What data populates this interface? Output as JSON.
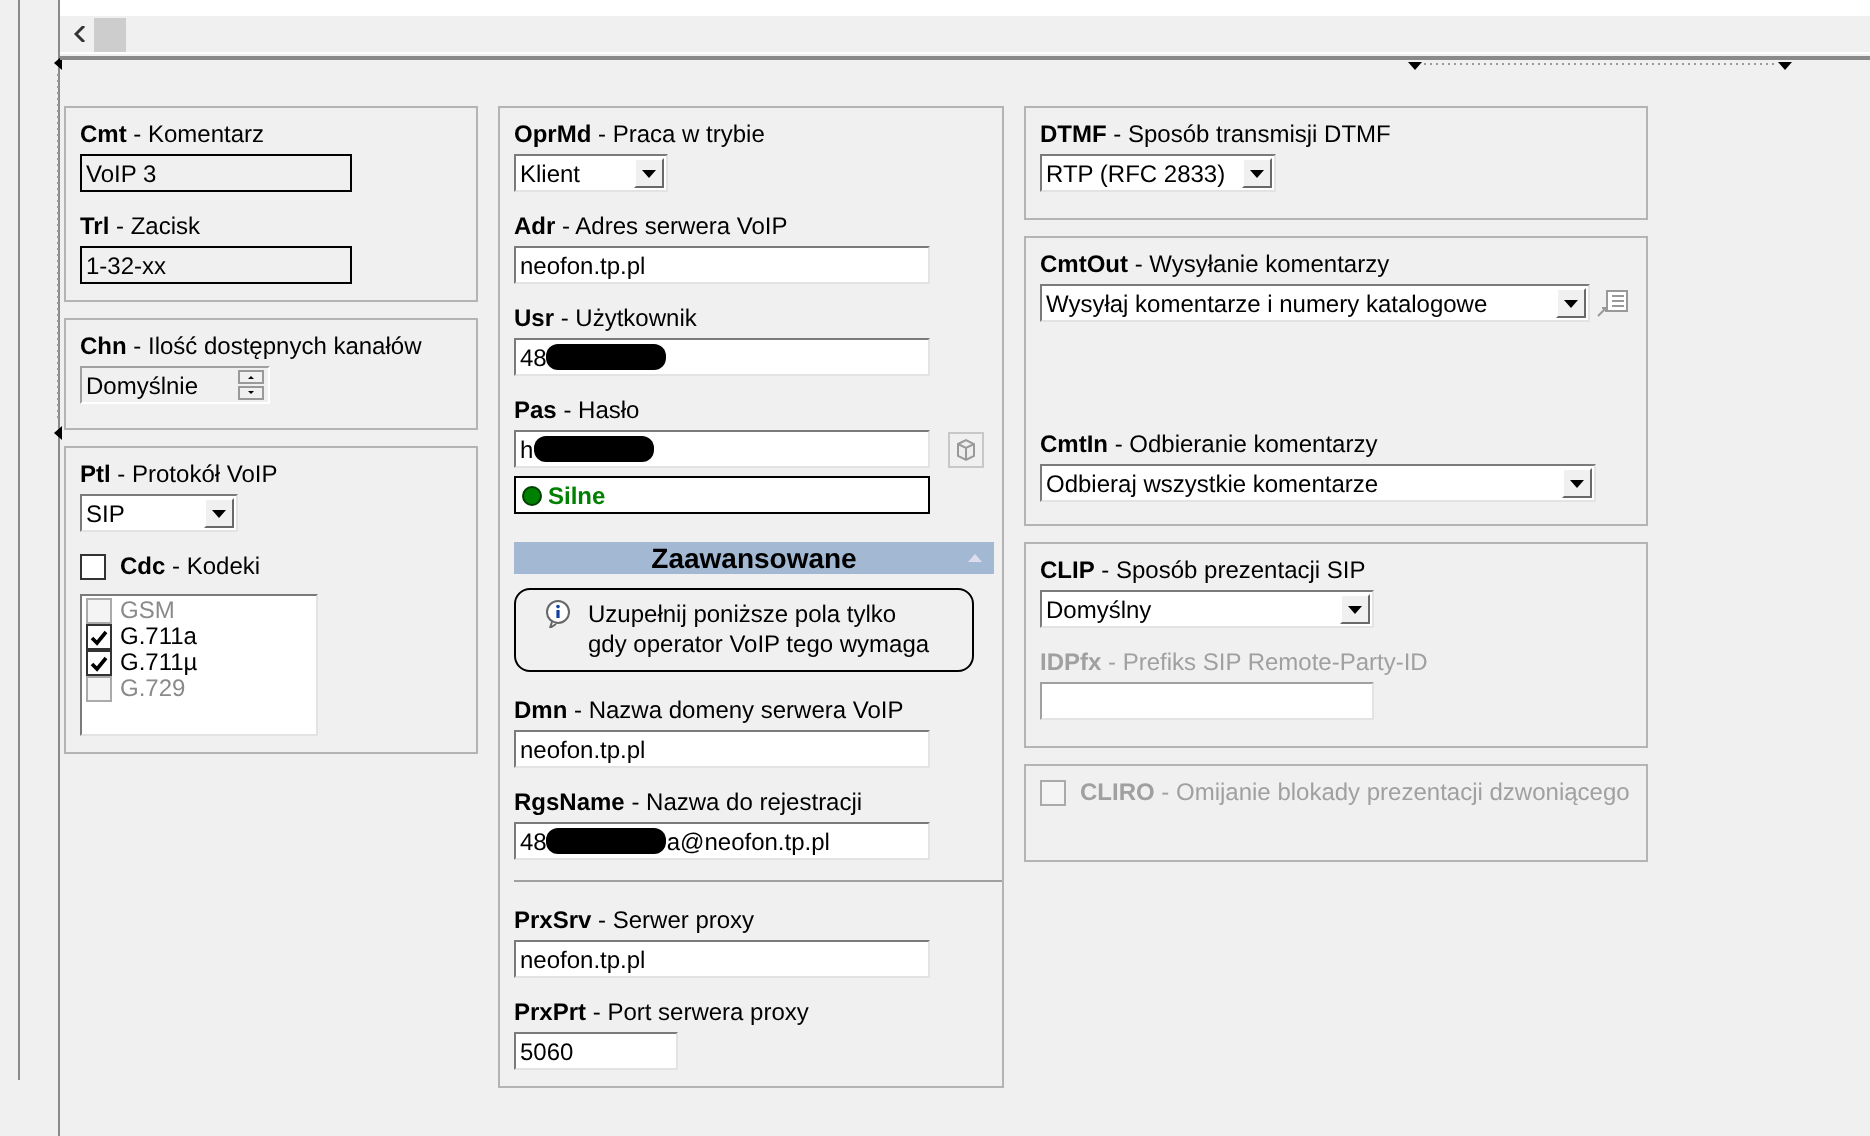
{
  "columns": [
    {
      "panels": [
        {
          "fields": [
            {
              "kind": "text",
              "label": "**Cmt** - Komentarz",
              "value": "VoIP 3",
              "readonly": true
            },
            {
              "kind": "text",
              "label": "**Trl** - Zacisk",
              "value": "1-32-xx",
              "readonly": true
            }
          ]
        },
        {
          "fields": [
            {
              "kind": "spin",
              "label": "**Chn** - Ilość dostępnych kanałów",
              "value": "Domyślnie"
            }
          ]
        },
        {
          "fields": [
            {
              "kind": "select",
              "label": "**Ptl** - Protokół VoIP",
              "value": "SIP"
            },
            {
              "kind": "checkbox",
              "label": "**Cdc** -  Kodeki",
              "checked": false,
              "disabled": false
            },
            {
              "kind": "checklist",
              "items": [
                {
                  "label": "GSM",
                  "checked": false,
                  "disabled": true
                },
                {
                  "label": "G.711a",
                  "checked": true,
                  "disabled": false
                },
                {
                  "label": "G.711µ",
                  "checked": true,
                  "disabled": false
                },
                {
                  "label": "G.729",
                  "checked": false,
                  "disabled": true
                }
              ]
            }
          ]
        }
      ]
    },
    {
      "panels": [
        {
          "fields": [
            {
              "kind": "select",
              "label": "**OprMd** - Praca w trybie",
              "value": "Klient"
            },
            {
              "kind": "text",
              "label": "**Adr** - Adres serwera VoIP",
              "value": "neofon.tp.pl",
              "readonly": false,
              "disabled": false
            },
            {
              "kind": "text",
              "label": "**Usr** - Użytkownik",
              "value": "48",
              "redacted": true,
              "readonly": false,
              "disabled": false
            },
            {
              "kind": "password",
              "label": "**Pas** - Hasło",
              "value": "h",
              "redacted": true
            },
            {
              "kind": "strength",
              "text": "Silne"
            },
            {
              "kind": "header",
              "text": "Zaawansowane",
              "expanded": true
            },
            {
              "kind": "note",
              "text": "Uzupełnij poniższe pola tylko gdy operator VoIP tego wymaga"
            },
            {
              "kind": "text",
              "label": "**Dmn** - Nazwa domeny serwera VoIP",
              "value": "neofon.tp.pl",
              "readonly": false,
              "disabled": false
            },
            {
              "kind": "text",
              "label": "**RgsName** - Nazwa do rejestracji",
              "value": "48",
              "redacted": true,
              "value_after": "a@neofon.tp.pl",
              "readonly": false,
              "disabled": false
            },
            {
              "kind": "separator"
            },
            {
              "kind": "text",
              "label": "**PrxSrv** - Serwer proxy",
              "value": "neofon.tp.pl",
              "readonly": false,
              "disabled": false
            },
            {
              "kind": "text",
              "label": "**PrxPrt** - Port serwera proxy",
              "value": "5060",
              "readonly": false,
              "disabled": false
            }
          ]
        }
      ]
    },
    {
      "panels": [
        {
          "fields": [
            {
              "kind": "select",
              "label": "**DTMF** - Sposób transmisji DTMF",
              "value": "RTP (RFC 2833)"
            }
          ]
        },
        {
          "fields": [
            {
              "kind": "select_extra",
              "label": "**CmtOut** - Wysyłanie komentarzy",
              "value": "Wysyłaj komentarze i numery katalogowe"
            },
            {
              "kind": "select",
              "label": "**CmtIn** - Odbieranie komentarzy",
              "value": "Odbieraj wszystkie komentarze"
            }
          ]
        },
        {
          "fields": [
            {
              "kind": "select",
              "label": "**CLIP** - Sposób prezentacji SIP",
              "value": "Domyślny"
            },
            {
              "kind": "text",
              "label": "**IDPfx** - Prefiks SIP Remote-Party-ID",
              "readonly": false,
              "disabled": true
            }
          ]
        },
        {
          "fields": [
            {
              "kind": "checkbox",
              "label": "**CLIRO** -  Omijanie blokady prezentacji dzwoniącego",
              "checked": false,
              "disabled": true
            }
          ]
        }
      ]
    }
  ]
}
